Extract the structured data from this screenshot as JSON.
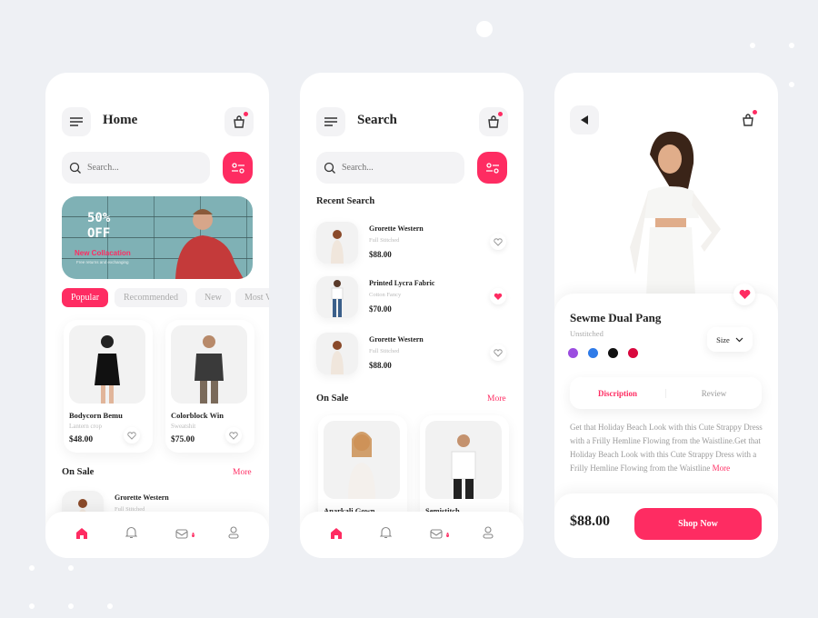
{
  "colors": {
    "accent": "#fe2c62",
    "background": "#eef0f4"
  },
  "home": {
    "title": "Home",
    "search_placeholder": "Search...",
    "banner": {
      "discount": "50%",
      "off": "OFF",
      "headline": "New Collacation",
      "subtitle": "Free returns and exchanging"
    },
    "chips": [
      "Popular",
      "Recommended",
      "New",
      "Most V"
    ],
    "products": [
      {
        "name": "Bodycorn Bemu",
        "sub": "Lantern crop",
        "price": "$48.00"
      },
      {
        "name": "Colorblock Win",
        "sub": "Sweatshit",
        "price": "$75.00"
      }
    ],
    "on_sale": "On Sale",
    "more": "More",
    "sale_item": {
      "name": "Grorette Western",
      "sub": "Full Stitched"
    },
    "nav_badge": "0"
  },
  "search": {
    "title": "Search",
    "search_placeholder": "Search...",
    "recent_title": "Recent Search",
    "recent": [
      {
        "name": "Grorette Western",
        "sub": "Full Stitched",
        "price": "$88.00",
        "liked": false
      },
      {
        "name": "Printed Lycra Fabric",
        "sub": "Cotton Fancy",
        "price": "$70.00",
        "liked": true
      },
      {
        "name": "Grorette Western",
        "sub": "Full Stitched",
        "price": "$88.00",
        "liked": false
      }
    ],
    "on_sale": "On Sale",
    "more": "More",
    "sale_products": [
      {
        "name": "Anarkali Gown"
      },
      {
        "name": "Semistitch"
      }
    ],
    "nav_badge": "0"
  },
  "detail": {
    "name": "Sewme Dual Pang",
    "sub": "Unstitched",
    "size_label": "Size",
    "colors": [
      "#9b4de0",
      "#2f7be8",
      "#111111",
      "#d9083e"
    ],
    "tabs": [
      "Discription",
      "Review"
    ],
    "description": "Get that Holiday Beach Look with this Cute Strappy Dress with a Frilly Hemline Flowing from the Waistline.Get that Holiday Beach Look with this Cute Strappy Dress with a Frilly Hemline Flowing from the Waistline",
    "more": "More",
    "price": "$88.00",
    "cta": "Shop Now"
  }
}
